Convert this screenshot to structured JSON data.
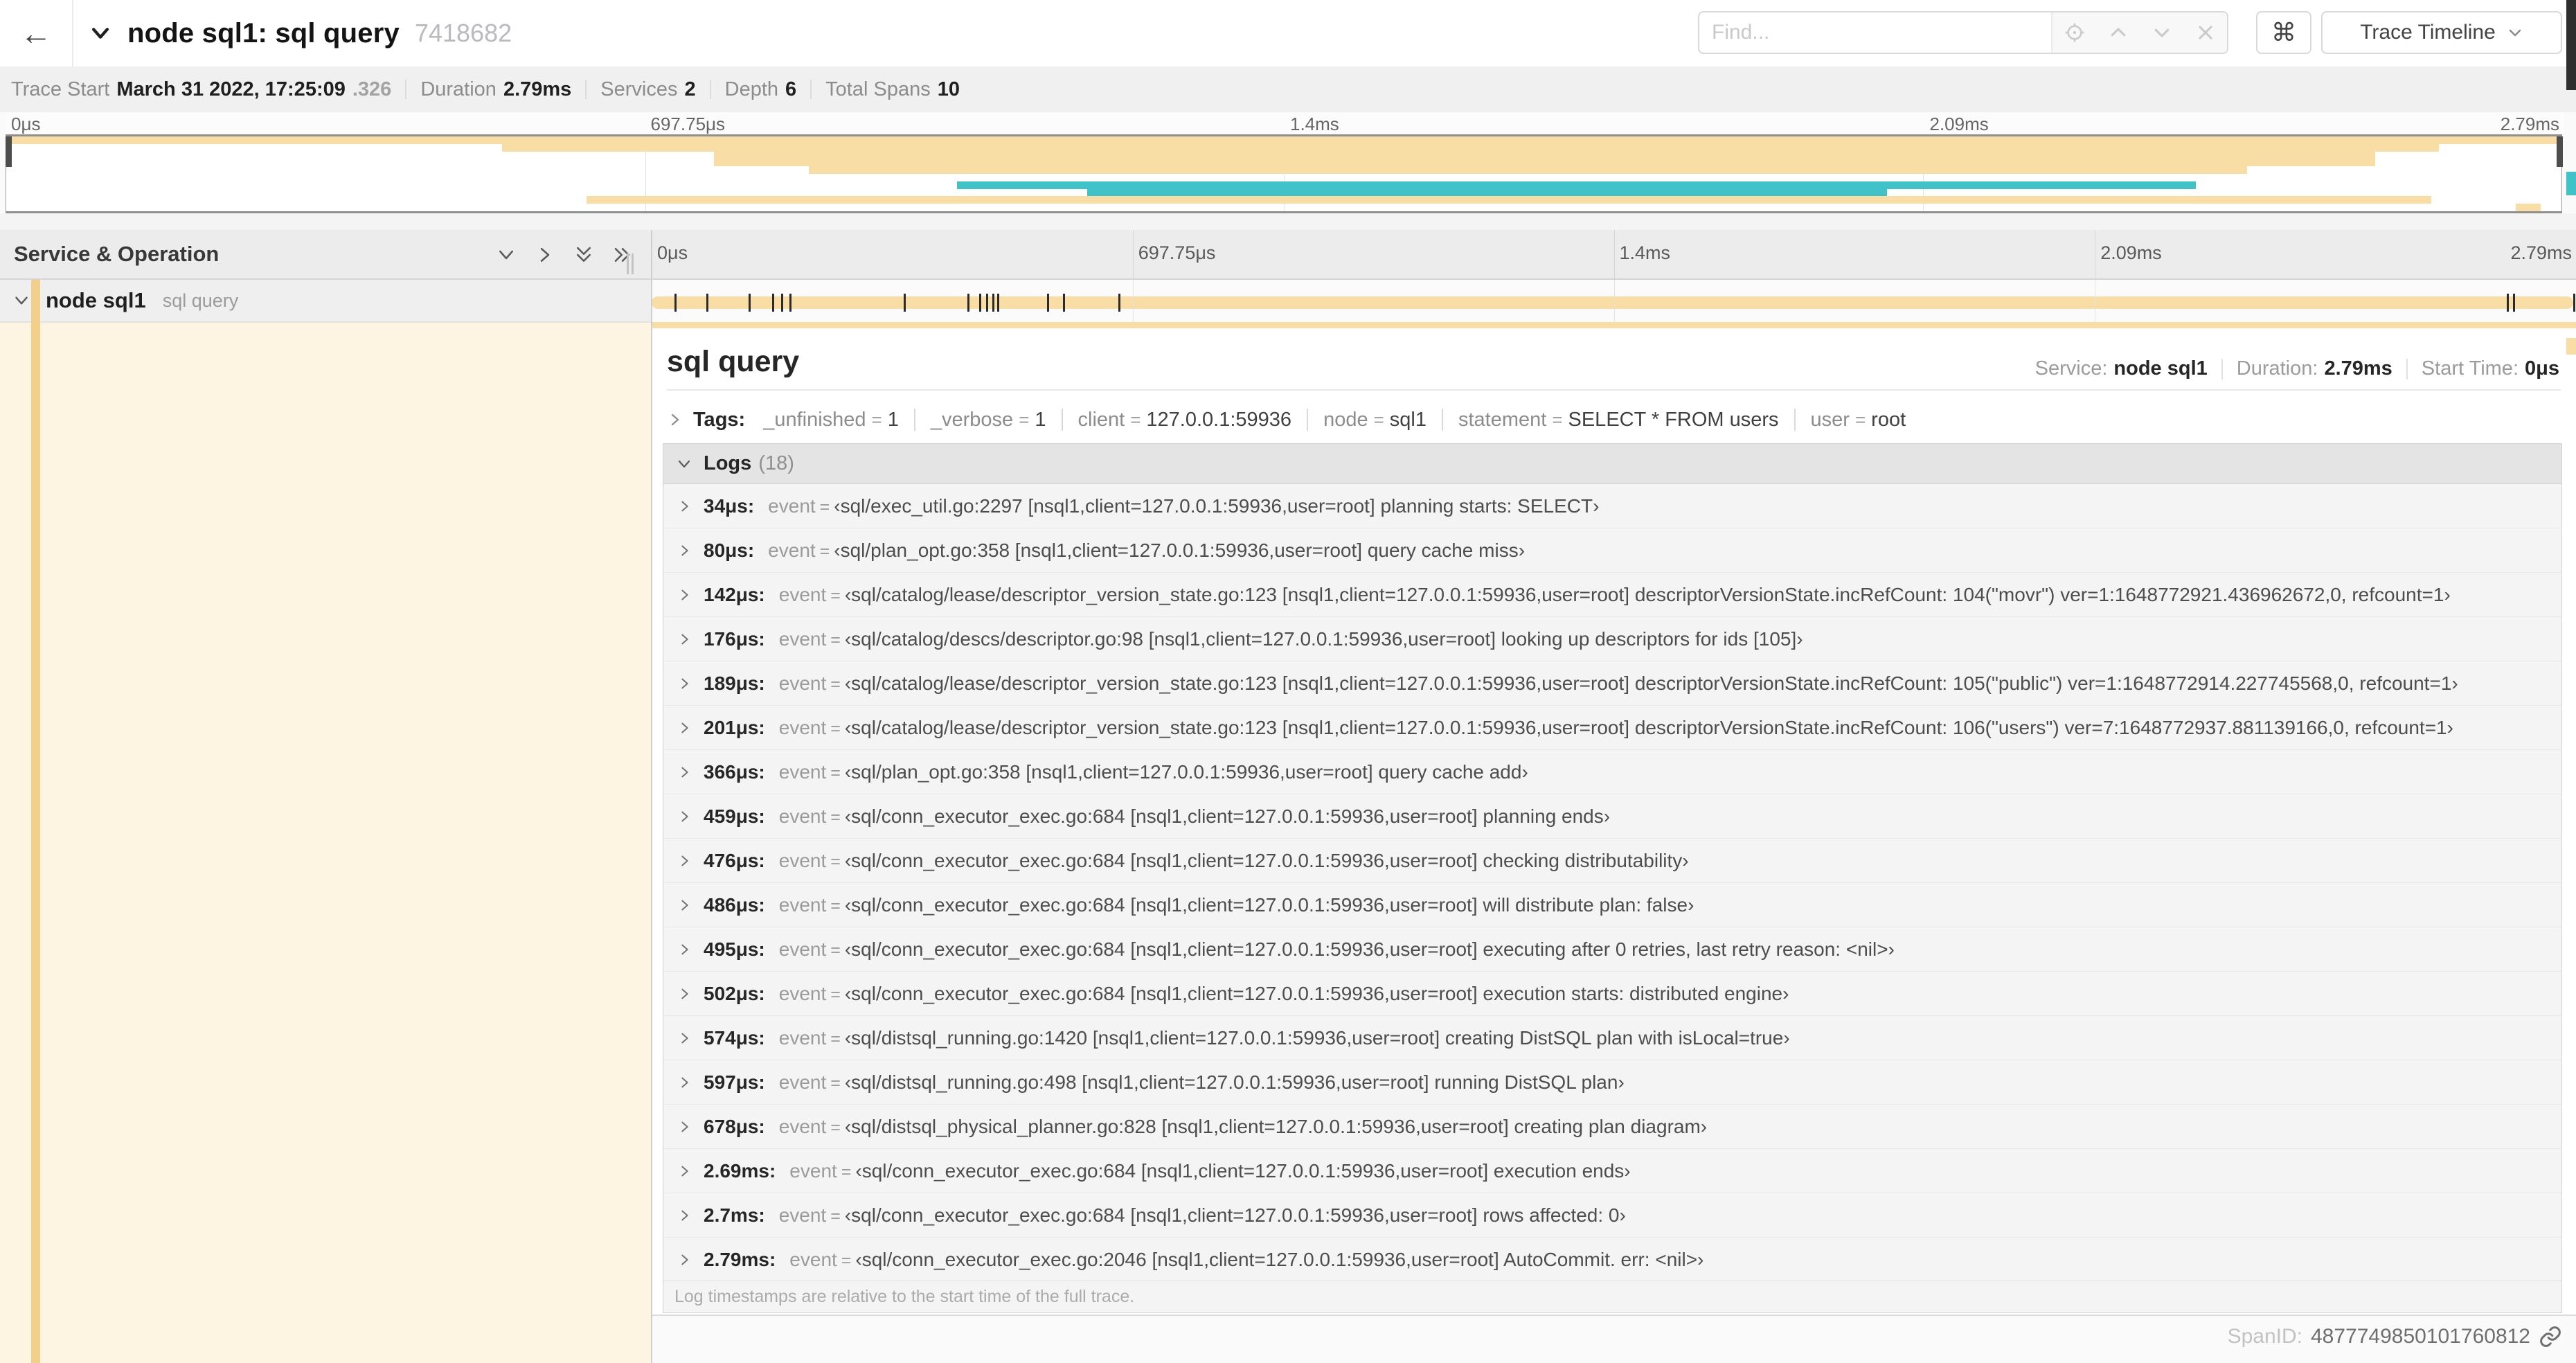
{
  "colors": {
    "tan": "#F8DDA4",
    "teal": "#3FC3C8",
    "stripe": "#F2CF8B",
    "cream": "#FDF5E2"
  },
  "header": {
    "back": "←",
    "title": "node sql1: sql query",
    "trace_id": "7418682",
    "find_placeholder": "Find...",
    "shortcut": "⌘",
    "view_select": "Trace Timeline"
  },
  "summary": {
    "trace_start_label": "Trace Start",
    "trace_start": "March 31 2022, 17:25:09",
    "trace_start_frac": ".326",
    "duration_label": "Duration",
    "duration": "2.79ms",
    "services_label": "Services",
    "services": "2",
    "depth_label": "Depth",
    "depth": "6",
    "spans_label": "Total Spans",
    "spans": "10"
  },
  "overview": {
    "ticks": [
      {
        "label": "0μs",
        "pct": 0
      },
      {
        "label": "697.75μs",
        "pct": 25
      },
      {
        "label": "1.4ms",
        "pct": 50
      },
      {
        "label": "2.09ms",
        "pct": 75
      },
      {
        "label": "2.79ms",
        "pct": 100
      }
    ],
    "grid_pcts": [
      25,
      50,
      75
    ],
    "rows": [
      [
        {
          "s": 0,
          "e": 100,
          "c": "tan"
        }
      ],
      [
        {
          "s": 19.4,
          "e": 95.2,
          "c": "tan"
        }
      ],
      [
        {
          "s": 27.7,
          "e": 92.7,
          "c": "tan"
        }
      ],
      [
        {
          "s": 27.7,
          "e": 92.7,
          "c": "tan"
        }
      ],
      [
        {
          "s": 31.4,
          "e": 87.7,
          "c": "tan"
        }
      ],
      [],
      [
        {
          "s": 37.2,
          "e": 85.7,
          "c": "teal"
        }
      ],
      [
        {
          "s": 42.3,
          "e": 73.6,
          "c": "teal"
        }
      ],
      [
        {
          "s": 22.7,
          "e": 94.9,
          "c": "tan"
        }
      ],
      [
        {
          "s": 98.2,
          "e": 99.2,
          "c": "tan"
        }
      ]
    ]
  },
  "spans_table": {
    "header_label": "Service & Operation"
  },
  "span_row": {
    "service": "node sql1",
    "operation": "sql query",
    "log_mark_pcts": [
      1.22,
      2.87,
      5.09,
      6.31,
      6.77,
      7.2,
      13.12,
      16.45,
      17.06,
      17.42,
      17.74,
      17.99,
      20.57,
      21.4,
      24.3,
      96.42,
      96.77,
      99.9
    ]
  },
  "detail": {
    "title": "sql query",
    "service_label": "Service:",
    "service": "node sql1",
    "duration_label": "Duration:",
    "duration": "2.79ms",
    "start_label": "Start Time:",
    "start": "0μs",
    "tags_label": "Tags:",
    "tags": [
      {
        "key": "_unfinished",
        "value": "1"
      },
      {
        "key": "_verbose",
        "value": "1"
      },
      {
        "key": "client",
        "value": "127.0.0.1:59936"
      },
      {
        "key": "node",
        "value": "sql1"
      },
      {
        "key": "statement",
        "value": "SELECT * FROM users"
      },
      {
        "key": "user",
        "value": "root"
      }
    ],
    "logs_label": "Logs",
    "logs_count": "(18)",
    "logs_key": "event",
    "logs": [
      {
        "t": "34μs:",
        "v": "‹sql/exec_util.go:2297 [nsql1,client=127.0.0.1:59936,user=root] planning starts: SELECT›"
      },
      {
        "t": "80μs:",
        "v": "‹sql/plan_opt.go:358 [nsql1,client=127.0.0.1:59936,user=root] query cache miss›"
      },
      {
        "t": "142μs:",
        "v": "‹sql/catalog/lease/descriptor_version_state.go:123 [nsql1,client=127.0.0.1:59936,user=root] descriptorVersionState.incRefCount: 104(\"movr\") ver=1:1648772921.436962672,0, refcount=1›"
      },
      {
        "t": "176μs:",
        "v": "‹sql/catalog/descs/descriptor.go:98 [nsql1,client=127.0.0.1:59936,user=root] looking up descriptors for ids [105]›"
      },
      {
        "t": "189μs:",
        "v": "‹sql/catalog/lease/descriptor_version_state.go:123 [nsql1,client=127.0.0.1:59936,user=root] descriptorVersionState.incRefCount: 105(\"public\") ver=1:1648772914.227745568,0, refcount=1›"
      },
      {
        "t": "201μs:",
        "v": "‹sql/catalog/lease/descriptor_version_state.go:123 [nsql1,client=127.0.0.1:59936,user=root] descriptorVersionState.incRefCount: 106(\"users\") ver=7:1648772937.881139166,0, refcount=1›"
      },
      {
        "t": "366μs:",
        "v": "‹sql/plan_opt.go:358 [nsql1,client=127.0.0.1:59936,user=root] query cache add›"
      },
      {
        "t": "459μs:",
        "v": "‹sql/conn_executor_exec.go:684 [nsql1,client=127.0.0.1:59936,user=root] planning ends›"
      },
      {
        "t": "476μs:",
        "v": "‹sql/conn_executor_exec.go:684 [nsql1,client=127.0.0.1:59936,user=root] checking distributability›"
      },
      {
        "t": "486μs:",
        "v": "‹sql/conn_executor_exec.go:684 [nsql1,client=127.0.0.1:59936,user=root] will distribute plan: false›"
      },
      {
        "t": "495μs:",
        "v": "‹sql/conn_executor_exec.go:684 [nsql1,client=127.0.0.1:59936,user=root] executing after 0 retries, last retry reason: <nil>›"
      },
      {
        "t": "502μs:",
        "v": "‹sql/conn_executor_exec.go:684 [nsql1,client=127.0.0.1:59936,user=root] execution starts: distributed engine›"
      },
      {
        "t": "574μs:",
        "v": "‹sql/distsql_running.go:1420 [nsql1,client=127.0.0.1:59936,user=root] creating DistSQL plan with isLocal=true›"
      },
      {
        "t": "597μs:",
        "v": "‹sql/distsql_running.go:498 [nsql1,client=127.0.0.1:59936,user=root] running DistSQL plan›"
      },
      {
        "t": "678μs:",
        "v": "‹sql/distsql_physical_planner.go:828 [nsql1,client=127.0.0.1:59936,user=root] creating plan diagram›"
      },
      {
        "t": "2.69ms:",
        "v": "‹sql/conn_executor_exec.go:684 [nsql1,client=127.0.0.1:59936,user=root] execution ends›"
      },
      {
        "t": "2.7ms:",
        "v": "‹sql/conn_executor_exec.go:684 [nsql1,client=127.0.0.1:59936,user=root] rows affected: 0›"
      },
      {
        "t": "2.79ms:",
        "v": "‹sql/conn_executor_exec.go:2046 [nsql1,client=127.0.0.1:59936,user=root] AutoCommit. err: <nil>›"
      }
    ],
    "footnote": "Log timestamps are relative to the start time of the full trace.",
    "spanid_label": "SpanID:",
    "spanid": "4877749850101760812"
  }
}
